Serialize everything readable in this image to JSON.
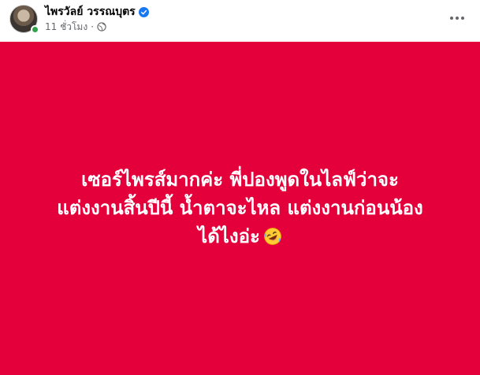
{
  "post": {
    "author": {
      "name": "ไพรวัลย์ วรรณบุตร",
      "verified": true,
      "online": true,
      "avatar_icon": "avatar-photo"
    },
    "meta": {
      "time": "11 ชั่วโมง",
      "separator": "·",
      "privacy_icon": "globe-icon"
    },
    "more_icon": "ellipsis-icon",
    "body": {
      "background_color": "#e4003b",
      "text_color": "#ffffff",
      "lines": [
        "เซอร์ไพรส์มากค่ะ พี่ปองพูดในไลฟ์ว่าจะ",
        "แต่งงานสิ้นปีนี้ น้ำตาจะไหล แต่งงานก่อนน้อง",
        "ได้ไงอ่ะ"
      ],
      "emoji": "rolling-on-the-floor-laughing"
    }
  }
}
